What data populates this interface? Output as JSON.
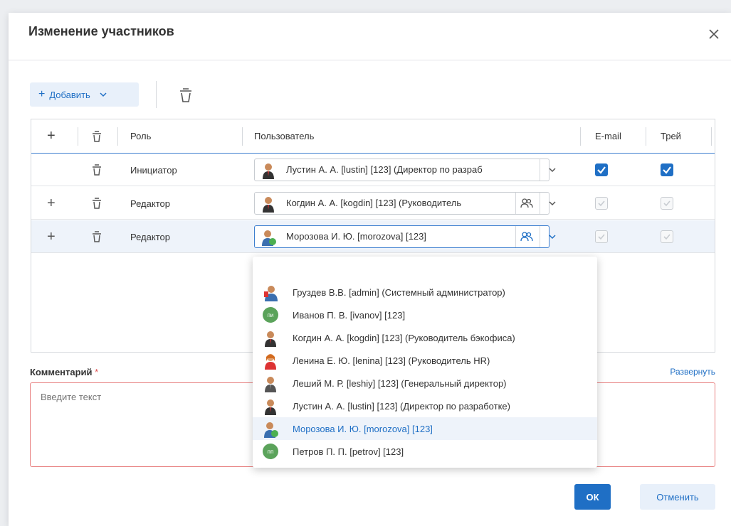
{
  "dialog": {
    "title": "Изменение участников",
    "close_icon": "close-icon"
  },
  "toolbar": {
    "add_label": "Добавить",
    "add_icon": "plus-icon",
    "delete_icon": "trash-icon"
  },
  "grid": {
    "columns": {
      "add": "+",
      "role": "Роль",
      "user": "Пользователь",
      "email": "E-mail",
      "tray": "Трей"
    },
    "rows": [
      {
        "role": "Инициатор",
        "user": "Лустин А. А. [lustin] [123] (Директор по разраб",
        "email_checked": true,
        "tray_checked": true,
        "can_add": false,
        "has_group": false
      },
      {
        "role": "Редактор",
        "user": "Когдин А. А. [kogdin] [123] (Руководитель",
        "email_checked": true,
        "tray_checked": true,
        "can_add": true,
        "has_group": true
      },
      {
        "role": "Редактор",
        "user": "Морозова И. Ю. [morozova] [123]",
        "email_checked": true,
        "tray_checked": true,
        "can_add": true,
        "has_group": true
      }
    ]
  },
  "dropdown": {
    "items": [
      {
        "label": "Груздев В.В. [admin] (Системный администратор)",
        "avatar": "admin"
      },
      {
        "label": "Иванов П. В. [ivanov] [123]",
        "avatar": "initials",
        "initials": "пи"
      },
      {
        "label": "Когдин А. А. [kogdin] [123] (Руководитель бэкофиса)",
        "avatar": "man"
      },
      {
        "label": "Ленина Е. Ю. [lenina] [123] (Руководитель HR)",
        "avatar": "woman"
      },
      {
        "label": "Леший М. Р. [leshiy] [123] (Генеральный директор)",
        "avatar": "boss"
      },
      {
        "label": "Лустин А. А. [lustin] [123] (Директор по разработке)",
        "avatar": "man"
      },
      {
        "label": "Морозова И. Ю. [morozova] [123]",
        "avatar": "green-man",
        "selected": true
      },
      {
        "label": "Петров П. П. [petrov] [123]",
        "avatar": "initials",
        "initials": "пп"
      }
    ]
  },
  "comment": {
    "label": "Комментарий",
    "required_mark": "*",
    "expand_label": "Развернуть",
    "placeholder": "Введите текст"
  },
  "buttons": {
    "ok": "ОК",
    "cancel": "Отменить"
  },
  "colors": {
    "accent": "#1f6fc5",
    "required": "#e05353",
    "selection": "#eef3fa"
  }
}
